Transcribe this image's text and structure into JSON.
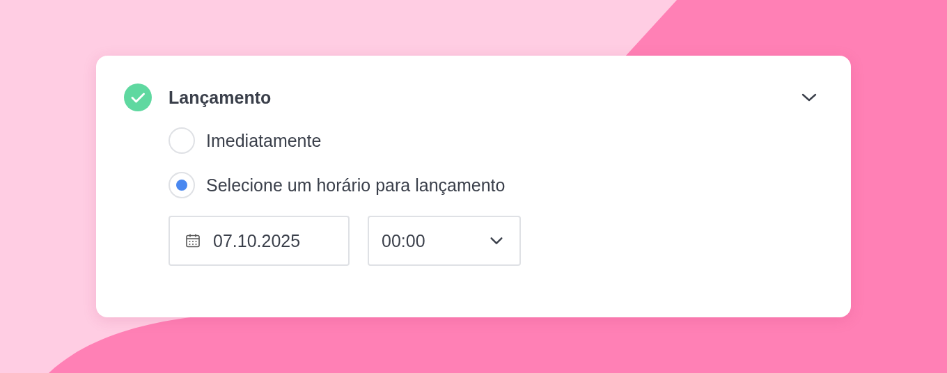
{
  "section": {
    "title": "Lançamento",
    "completed": true,
    "expanded": true,
    "options": [
      {
        "label": "Imediatamente",
        "selected": false
      },
      {
        "label": "Selecione um horário para lançamento",
        "selected": true
      }
    ],
    "date_field": {
      "value": "07.10.2025"
    },
    "time_select": {
      "value": "00:00"
    }
  }
}
